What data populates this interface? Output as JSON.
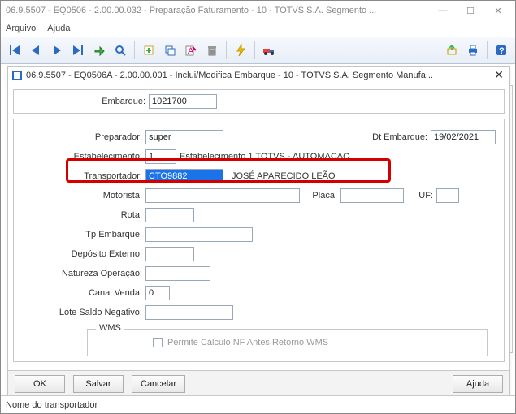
{
  "window": {
    "title": "06.9.5507 - EQ0506 - 2.00.00.032 - Preparação Faturamento - 10 - TOTVS S.A. Segmento ...",
    "min": "—",
    "max": "☐",
    "close": "✕"
  },
  "menu": {
    "arquivo": "Arquivo",
    "ajuda": "Ajuda"
  },
  "modal": {
    "title": "06.9.5507 - EQ0506A - 2.00.00.001 - Inclui/Modifica Embarque - 10 - TOTVS S.A. Segmento Manufa..."
  },
  "labels": {
    "embarque": "Embarque:",
    "preparador": "Preparador:",
    "dt_embarque": "Dt Embarque:",
    "estabelecimento": "Estabelecimento:",
    "transportador": "Transportador:",
    "motorista": "Motorista:",
    "placa": "Placa:",
    "uf": "UF:",
    "rota": "Rota:",
    "tp_embarque": "Tp Embarque:",
    "deposito_externo": "Depósito Externo:",
    "natureza_operacao": "Natureza Operação:",
    "canal_venda": "Canal Venda:",
    "lote_saldo_negativo": "Lote Saldo Negativo:",
    "wms_legend": "WMS",
    "wms_chk": "Permite Cálculo NF Antes Retorno WMS"
  },
  "values": {
    "embarque": "1021700",
    "preparador": "super",
    "dt_embarque": "19/02/2021",
    "estabelecimento": "1",
    "estab_desc": "Estabelecimento 1 TOTVS - AUTOMACAO",
    "transportador": "CTO9882",
    "transportador_nome": "JOSÉ APARECIDO LEÃO",
    "motorista": "",
    "placa": "",
    "uf": "",
    "rota": "",
    "tp_embarque": "",
    "deposito_externo": "",
    "natureza_operacao": "",
    "canal_venda": "0",
    "lote_saldo_negativo": ""
  },
  "buttons": {
    "ok": "OK",
    "salvar": "Salvar",
    "cancelar": "Cancelar",
    "ajuda": "Ajuda"
  },
  "status": "Nome do transportador"
}
